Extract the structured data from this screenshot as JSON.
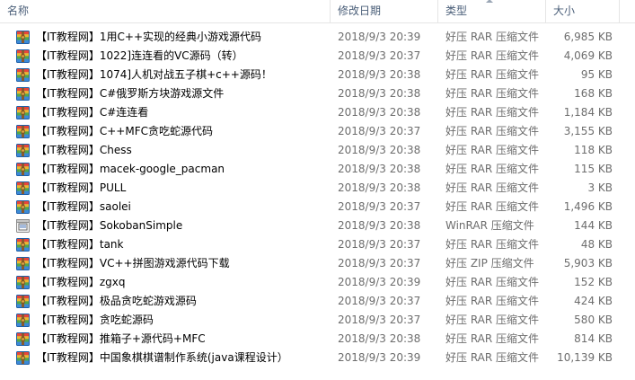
{
  "columns": {
    "name": "名称",
    "date": "修改日期",
    "type": "类型",
    "size": "大小"
  },
  "files": [
    {
      "name": "【IT教程网】1用C++实现的经典小游戏源代码",
      "date": "2018/9/3 20:39",
      "type": "好压 RAR 压缩文件",
      "size": "6,985 KB",
      "icon": "rar-archive-icon"
    },
    {
      "name": "【IT教程网】1022]连连看的VC源码（转）",
      "date": "2018/9/3 20:37",
      "type": "好压 RAR 压缩文件",
      "size": "4,069 KB",
      "icon": "rar-archive-icon"
    },
    {
      "name": "【IT教程网】1074]人机对战五子棋+c++源码！",
      "date": "2018/9/3 20:38",
      "type": "好压 RAR 压缩文件",
      "size": "95 KB",
      "icon": "rar-archive-icon"
    },
    {
      "name": "【IT教程网】C#俄罗斯方块游戏源文件",
      "date": "2018/9/3 20:38",
      "type": "好压 RAR 压缩文件",
      "size": "168 KB",
      "icon": "rar-archive-icon"
    },
    {
      "name": "【IT教程网】C#连连看",
      "date": "2018/9/3 20:38",
      "type": "好压 RAR 压缩文件",
      "size": "1,184 KB",
      "icon": "rar-archive-icon"
    },
    {
      "name": "【IT教程网】C++MFC贪吃蛇源代码",
      "date": "2018/9/3 20:37",
      "type": "好压 RAR 压缩文件",
      "size": "3,155 KB",
      "icon": "rar-archive-icon"
    },
    {
      "name": "【IT教程网】Chess",
      "date": "2018/9/3 20:38",
      "type": "好压 RAR 压缩文件",
      "size": "118 KB",
      "icon": "rar-archive-icon"
    },
    {
      "name": "【IT教程网】macek-google_pacman",
      "date": "2018/9/3 20:38",
      "type": "好压 RAR 压缩文件",
      "size": "115 KB",
      "icon": "rar-archive-icon"
    },
    {
      "name": "【IT教程网】PULL",
      "date": "2018/9/3 20:38",
      "type": "好压 RAR 压缩文件",
      "size": "3 KB",
      "icon": "rar-archive-icon"
    },
    {
      "name": "【IT教程网】saolei",
      "date": "2018/9/3 20:37",
      "type": "好压 RAR 压缩文件",
      "size": "1,496 KB",
      "icon": "rar-archive-icon"
    },
    {
      "name": "【IT教程网】SokobanSimple",
      "date": "2018/9/3 20:38",
      "type": "WinRAR 压缩文件",
      "size": "144 KB",
      "icon": "winrar-archive-icon"
    },
    {
      "name": "【IT教程网】tank",
      "date": "2018/9/3 20:37",
      "type": "好压 RAR 压缩文件",
      "size": "48 KB",
      "icon": "rar-archive-icon"
    },
    {
      "name": "【IT教程网】VC++拼图游戏源代码下载",
      "date": "2018/9/3 20:37",
      "type": "好压 ZIP 压缩文件",
      "size": "5,903 KB",
      "icon": "rar-archive-icon"
    },
    {
      "name": "【IT教程网】zgxq",
      "date": "2018/9/3 20:39",
      "type": "好压 RAR 压缩文件",
      "size": "152 KB",
      "icon": "rar-archive-icon"
    },
    {
      "name": "【IT教程网】极品贪吃蛇游戏源码",
      "date": "2018/9/3 20:37",
      "type": "好压 RAR 压缩文件",
      "size": "424 KB",
      "icon": "rar-archive-icon"
    },
    {
      "name": "【IT教程网】贪吃蛇源码",
      "date": "2018/9/3 20:37",
      "type": "好压 RAR 压缩文件",
      "size": "580 KB",
      "icon": "rar-archive-icon"
    },
    {
      "name": "【IT教程网】推箱子+源代码+MFC",
      "date": "2018/9/3 20:38",
      "type": "好压 RAR 压缩文件",
      "size": "814 KB",
      "icon": "rar-archive-icon"
    },
    {
      "name": "【IT教程网】中国象棋棋谱制作系统(java课程设计）",
      "date": "2018/9/3 20:39",
      "type": "好压 RAR 压缩文件",
      "size": "10,139 KB",
      "icon": "rar-archive-icon"
    }
  ]
}
